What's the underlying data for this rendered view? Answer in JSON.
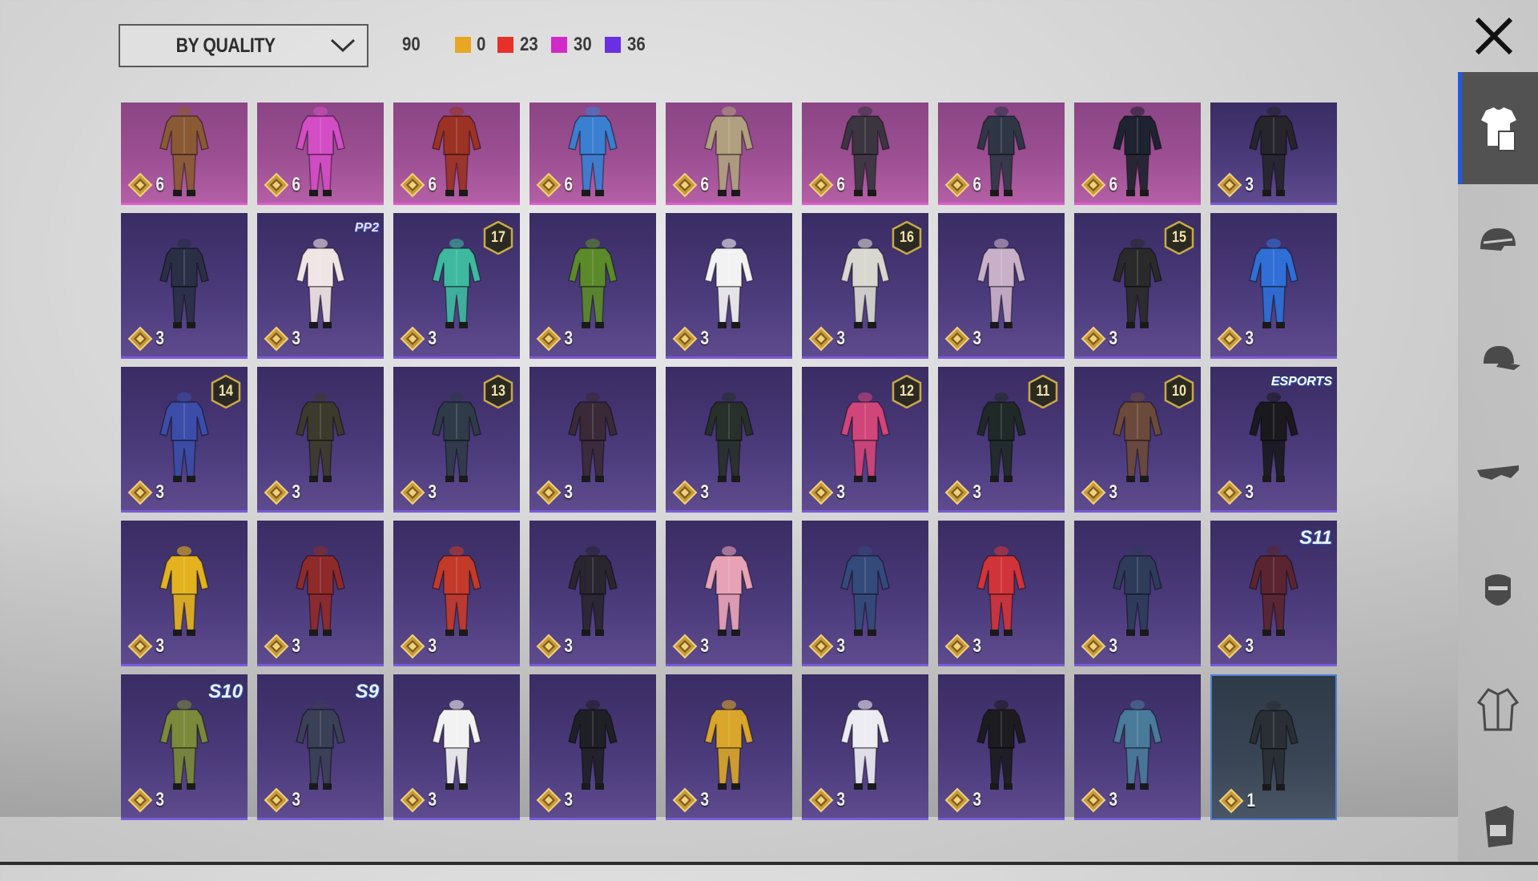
{
  "toolbar": {
    "sort_label": "BY QUALITY",
    "total_count": "90",
    "legend": [
      {
        "color": "#e8a623",
        "count": "0"
      },
      {
        "color": "#e8302a",
        "count": "23"
      },
      {
        "color": "#d329c9",
        "count": "30"
      },
      {
        "color": "#6a2fe0",
        "count": "36"
      }
    ]
  },
  "close_icon": "close-icon",
  "colors": {
    "legendary_card": "#9c4f92",
    "epic_card": "#4a3a7a",
    "active_tab_accent": "#1e5be0"
  },
  "side_tabs": [
    {
      "icon": "outfit-icon",
      "active": true
    },
    {
      "icon": "helmet-icon",
      "active": false
    },
    {
      "icon": "cap-icon",
      "active": false
    },
    {
      "icon": "glasses-icon",
      "active": false
    },
    {
      "icon": "mask-icon",
      "active": false
    },
    {
      "icon": "jacket-icon",
      "active": false
    },
    {
      "icon": "backpack-icon",
      "active": false
    }
  ],
  "items": [
    {
      "quality": "legendary",
      "count": "6",
      "outfit": "#8a5a34"
    },
    {
      "quality": "legendary",
      "count": "6",
      "outfit": "#d34dc5"
    },
    {
      "quality": "legendary",
      "count": "6",
      "outfit": "#9b3224"
    },
    {
      "quality": "legendary",
      "count": "6",
      "outfit": "#3a7fd0"
    },
    {
      "quality": "legendary",
      "count": "6",
      "outfit": "#b0a080"
    },
    {
      "quality": "legendary",
      "count": "6",
      "outfit": "#3b3540"
    },
    {
      "quality": "legendary",
      "count": "6",
      "outfit": "#2f3747"
    },
    {
      "quality": "legendary",
      "count": "6",
      "outfit": "#1f2230"
    },
    {
      "quality": "epic",
      "count": "3",
      "outfit": "#25252b"
    },
    {
      "quality": "epic",
      "count": "3",
      "outfit": "#2a2f45"
    },
    {
      "quality": "epic",
      "count": "3",
      "outfit": "#f0e5e5",
      "tag": "PP2",
      "tag_type": "pp"
    },
    {
      "quality": "epic",
      "count": "3",
      "outfit": "#3fb8a0",
      "level": "17"
    },
    {
      "quality": "epic",
      "count": "3",
      "outfit": "#5b8a2a"
    },
    {
      "quality": "epic",
      "count": "3",
      "outfit": "#f2f2f2"
    },
    {
      "quality": "epic",
      "count": "3",
      "outfit": "#d8d8d0",
      "level": "16"
    },
    {
      "quality": "epic",
      "count": "3",
      "outfit": "#c9b0c9"
    },
    {
      "quality": "epic",
      "count": "3",
      "outfit": "#2a2a2a",
      "level": "15"
    },
    {
      "quality": "epic",
      "count": "3",
      "outfit": "#2f6fd6"
    },
    {
      "quality": "epic",
      "count": "3",
      "outfit": "#3b4da8",
      "level": "14"
    },
    {
      "quality": "epic",
      "count": "3",
      "outfit": "#3c3a2c"
    },
    {
      "quality": "epic",
      "count": "3",
      "outfit": "#2f3b48",
      "level": "13"
    },
    {
      "quality": "epic",
      "count": "3",
      "outfit": "#3a2a38"
    },
    {
      "quality": "epic",
      "count": "3",
      "outfit": "#27302a"
    },
    {
      "quality": "epic",
      "count": "3",
      "outfit": "#d0457a",
      "level": "12"
    },
    {
      "quality": "epic",
      "count": "3",
      "outfit": "#1f2a28",
      "level": "11"
    },
    {
      "quality": "epic",
      "count": "3",
      "outfit": "#6b4a3c",
      "level": "10"
    },
    {
      "quality": "epic",
      "count": "3",
      "outfit": "#1a1a1e",
      "tag": "ESPORTS",
      "tag_type": "esports"
    },
    {
      "quality": "epic",
      "count": "3",
      "outfit": "#e3b21e"
    },
    {
      "quality": "epic",
      "count": "3",
      "outfit": "#8f2a2a"
    },
    {
      "quality": "epic",
      "count": "3",
      "outfit": "#c33a2a"
    },
    {
      "quality": "epic",
      "count": "3",
      "outfit": "#2a2630"
    },
    {
      "quality": "epic",
      "count": "3",
      "outfit": "#e8a2b8"
    },
    {
      "quality": "epic",
      "count": "3",
      "outfit": "#344a7a"
    },
    {
      "quality": "epic",
      "count": "3",
      "outfit": "#d0343a"
    },
    {
      "quality": "epic",
      "count": "3",
      "outfit": "#2e3c5a"
    },
    {
      "quality": "epic",
      "count": "3",
      "outfit": "#5a2530",
      "tag": "S11",
      "tag_type": "season"
    },
    {
      "quality": "epic",
      "count": "3",
      "outfit": "#7a8a3a",
      "tag": "S10",
      "tag_type": "season"
    },
    {
      "quality": "epic",
      "count": "3",
      "outfit": "#3a4055",
      "tag": "S9",
      "tag_type": "season"
    },
    {
      "quality": "epic",
      "count": "3",
      "outfit": "#f2f2f2"
    },
    {
      "quality": "epic",
      "count": "3",
      "outfit": "#1f1f26"
    },
    {
      "quality": "epic",
      "count": "3",
      "outfit": "#d9a52a"
    },
    {
      "quality": "epic",
      "count": "3",
      "outfit": "#ececf2"
    },
    {
      "quality": "epic",
      "count": "3",
      "outfit": "#1c1c20"
    },
    {
      "quality": "epic",
      "count": "3",
      "outfit": "#4a7a9a"
    },
    {
      "quality": "plain",
      "count": "1",
      "outfit": "#2a2f35"
    }
  ]
}
